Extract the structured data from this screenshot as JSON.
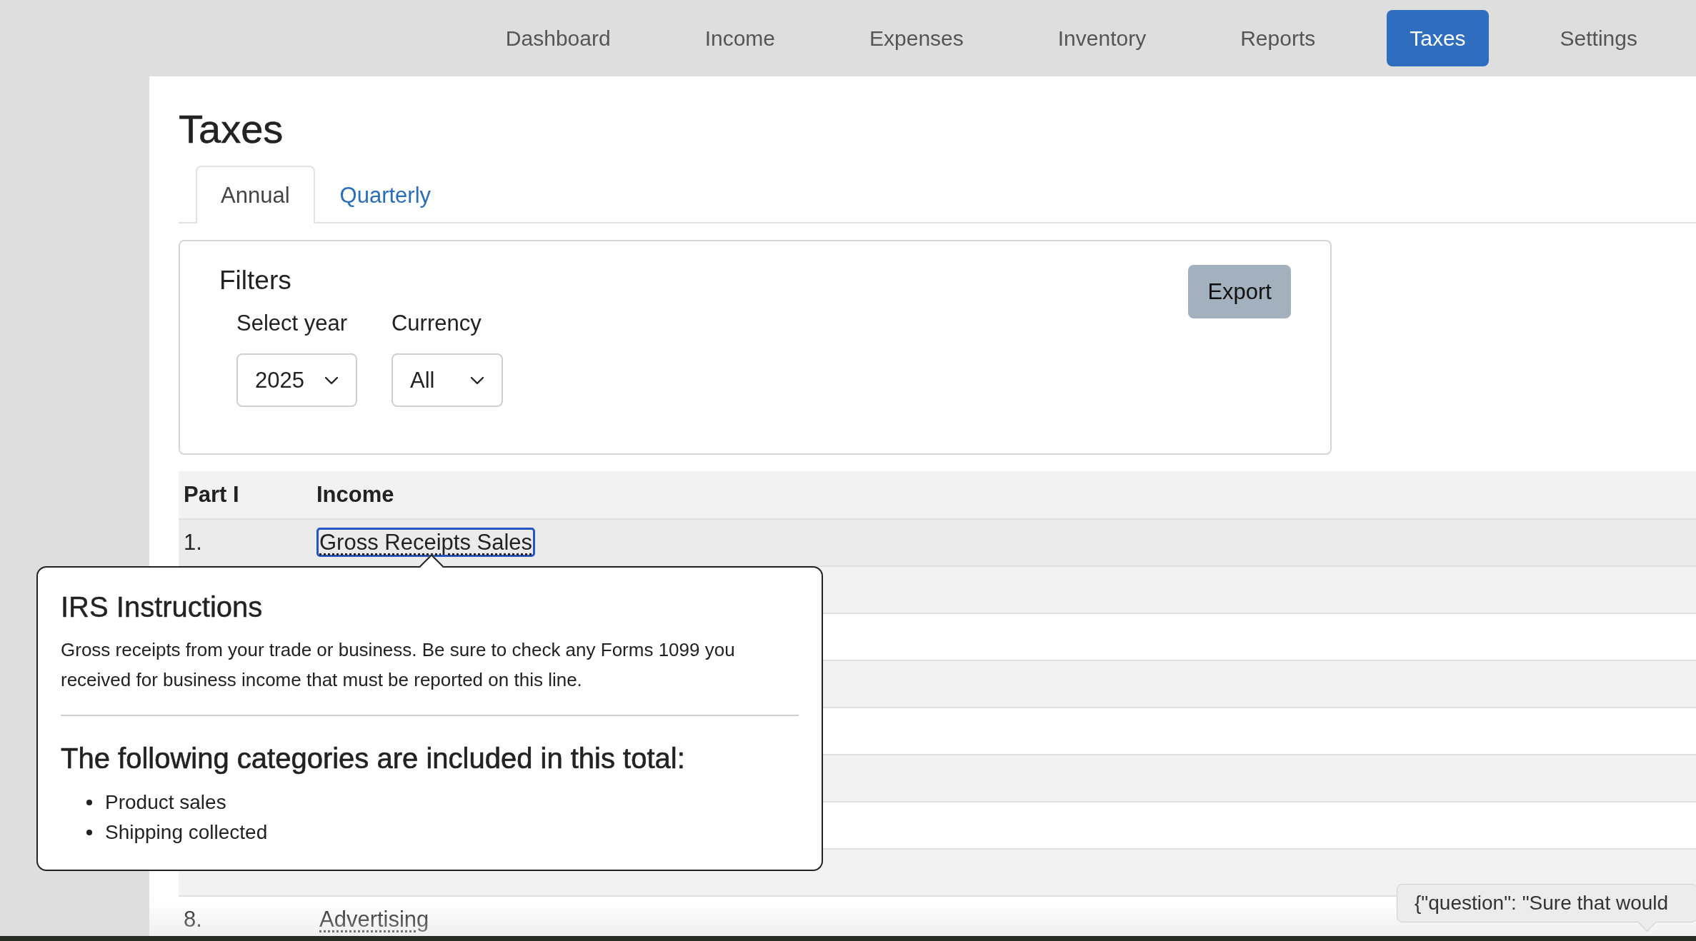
{
  "nav": {
    "items": [
      {
        "label": "Dashboard",
        "selected": false
      },
      {
        "label": "Income",
        "selected": false
      },
      {
        "label": "Expenses",
        "selected": false
      },
      {
        "label": "Inventory",
        "selected": false
      },
      {
        "label": "Reports",
        "selected": false
      },
      {
        "label": "Taxes",
        "selected": true
      },
      {
        "label": "Settings",
        "selected": false
      }
    ]
  },
  "page": {
    "title": "Taxes"
  },
  "tabs": [
    {
      "label": "Annual",
      "selected": true
    },
    {
      "label": "Quarterly",
      "selected": false
    }
  ],
  "filters": {
    "title": "Filters",
    "fields": [
      {
        "label": "Select year",
        "value": "2025"
      },
      {
        "label": "Currency",
        "value": "All"
      }
    ],
    "export_button": "Export"
  },
  "table": {
    "rows": [
      {
        "kind": "section",
        "part": "Part I",
        "title": "Income"
      },
      {
        "kind": "line",
        "number": "1.",
        "label": "Gross Receipts Sales",
        "selected": true
      },
      {
        "kind": "covered"
      },
      {
        "kind": "covered"
      },
      {
        "kind": "covered"
      },
      {
        "kind": "covered"
      },
      {
        "kind": "covered"
      },
      {
        "kind": "covered"
      },
      {
        "kind": "covered"
      },
      {
        "kind": "line",
        "number": "8.",
        "label": "Advertising",
        "selected": false
      }
    ]
  },
  "popover": {
    "title": "IRS Instructions",
    "text": "Gross receipts from your trade or business. Be sure to check any Forms 1099 you received for business income that must be reported on this line.",
    "subtitle": "The following categories are included in this total:",
    "items": [
      "Product sales",
      "Shipping collected"
    ]
  },
  "tooltip": {
    "text": "{\"question\": \"Sure that would"
  }
}
